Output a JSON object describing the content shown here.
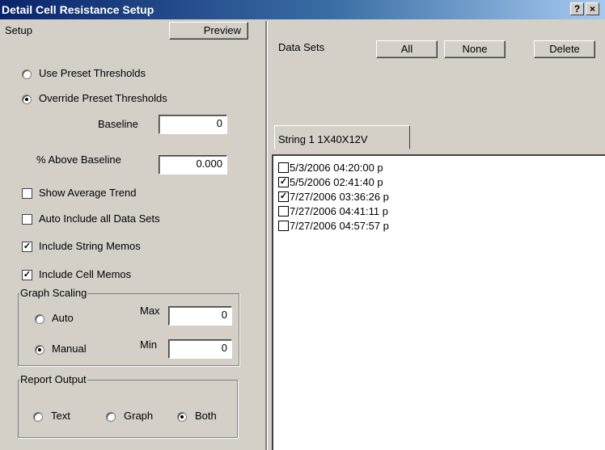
{
  "window": {
    "title": "Detail Cell Resistance Setup",
    "help_label": "?",
    "close_label": "×"
  },
  "setup": {
    "label": "Setup",
    "preview_label": "Preview",
    "use_preset": "Use Preset Thresholds",
    "override_preset": "Override Preset Thresholds",
    "threshold_mode": "override",
    "baseline_label": "Baseline",
    "baseline_value": "0",
    "above_label": "% Above Baseline",
    "above_value": "0.000",
    "show_avg_trend": {
      "label": "Show Average Trend",
      "checked": false
    },
    "auto_include": {
      "label": "Auto Include all Data Sets",
      "checked": false
    },
    "string_memos": {
      "label": "Include String Memos",
      "checked": true
    },
    "cell_memos": {
      "label": "Include Cell Memos",
      "checked": true
    }
  },
  "graph_scaling": {
    "label": "Graph Scaling",
    "auto_label": "Auto",
    "manual_label": "Manual",
    "mode": "manual",
    "max_label": "Max",
    "max_value": "0",
    "min_label": "Min",
    "min_value": "0"
  },
  "report_output": {
    "label": "Report Output",
    "text_label": "Text",
    "graph_label": "Graph",
    "both_label": "Both",
    "mode": "both"
  },
  "data_sets": {
    "label": "Data Sets",
    "all_label": "All",
    "none_label": "None",
    "delete_label": "Delete",
    "tab_label": "String 1 1X40X12V",
    "items": [
      {
        "label": "5/3/2006 04:20:00 p",
        "checked": false
      },
      {
        "label": "5/5/2006 02:41:40 p",
        "checked": true
      },
      {
        "label": "7/27/2006 03:36:26 p",
        "checked": true
      },
      {
        "label": "7/27/2006 04:41:11 p",
        "checked": false
      },
      {
        "label": "7/27/2006 04:57:57 p",
        "checked": false
      }
    ]
  }
}
